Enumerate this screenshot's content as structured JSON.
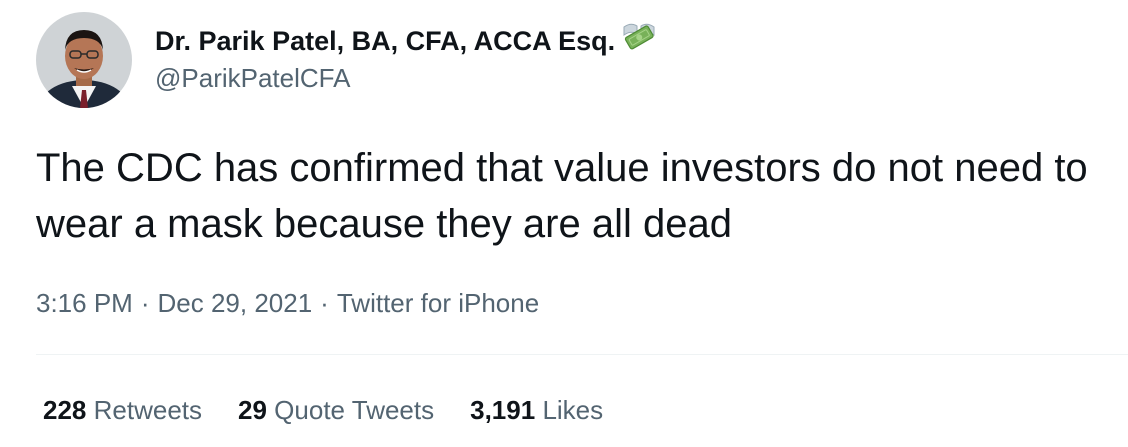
{
  "author": {
    "display_name": "Dr. Parik Patel, BA, CFA, ACCA Esq.",
    "handle": "@ParikPatelCFA",
    "name_emoji": "money-with-wings-icon"
  },
  "tweet": {
    "text": "The CDC has confirmed that value investors do not need to wear a mask because they are all dead",
    "time": "3:16 PM",
    "date": "Dec 29, 2021",
    "source": "Twitter for iPhone",
    "separator": "·"
  },
  "stats": {
    "retweets_count": "228",
    "retweets_label": "Retweets",
    "quote_tweets_count": "29",
    "quote_tweets_label": "Quote Tweets",
    "likes_count": "3,191",
    "likes_label": "Likes"
  },
  "colors": {
    "primary_text": "#0f1419",
    "secondary_text": "#536471",
    "divider": "#eff3f4"
  }
}
